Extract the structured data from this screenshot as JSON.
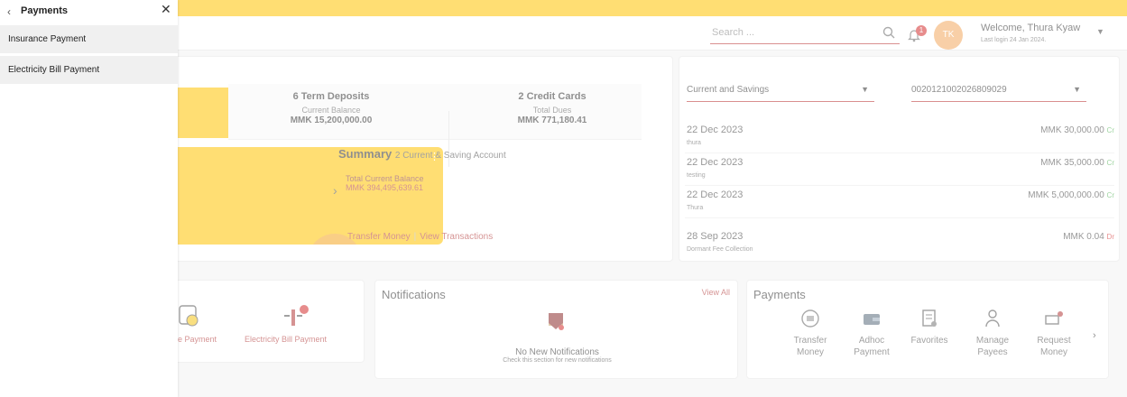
{
  "header": {
    "search_placeholder": "Search ...",
    "notification_count": "1",
    "avatar_initials": "TK",
    "welcome_text": "Welcome, Thura Kyaw",
    "last_login": "Last login 24 Jan 2024."
  },
  "summary": {
    "stats": [
      {
        "title": "6 Term Deposits",
        "label": "Current Balance",
        "value": "MMK 15,200,000.00"
      },
      {
        "title": "2 Credit Cards",
        "label": "Total Dues",
        "value": "MMK 771,180.41"
      }
    ],
    "title": "Summary",
    "subtitle": "2 Current & Saving Account",
    "total_label": "Total Current Balance",
    "total_value": "MMK 394,495,639.61",
    "transfer_link": "Transfer Money",
    "view_link": "View Transactions"
  },
  "transactions": {
    "account_type": "Current and Savings",
    "account_number": "0020121002026809029",
    "rows": [
      {
        "date": "22 Dec 2023",
        "desc": "thura",
        "amount": "MMK 30,000.00",
        "type": "Cr"
      },
      {
        "date": "22 Dec 2023",
        "desc": "testing",
        "amount": "MMK 35,000.00",
        "type": "Cr"
      },
      {
        "date": "22 Dec 2023",
        "desc": "Thura",
        "amount": "MMK 5,000,000.00",
        "type": "Cr"
      },
      {
        "date": "28 Sep 2023",
        "desc": "Dormant Fee Collection",
        "amount": "MMK 0.04",
        "type": "Dr"
      }
    ]
  },
  "favorites": {
    "items": [
      {
        "label": "e Payment"
      },
      {
        "label": "Electricity Bill Payment"
      }
    ]
  },
  "notifications": {
    "title": "Notifications",
    "view_all": "View All",
    "empty": "No New Notifications",
    "empty_sub": "Check this section for new notifications"
  },
  "payments": {
    "title": "Payments",
    "items": [
      {
        "label": "Transfer Money"
      },
      {
        "label": "Adhoc Payment"
      },
      {
        "label": "Favorites"
      },
      {
        "label": "Manage Payees"
      },
      {
        "label": "Request Money"
      }
    ]
  },
  "panel": {
    "title": "Payments",
    "items": [
      {
        "label": "Insurance Payment"
      },
      {
        "label": "Electricity Bill Payment"
      }
    ]
  },
  "colors": {
    "brand_yellow": "#ffc400",
    "accent_red": "#b23b3b"
  }
}
